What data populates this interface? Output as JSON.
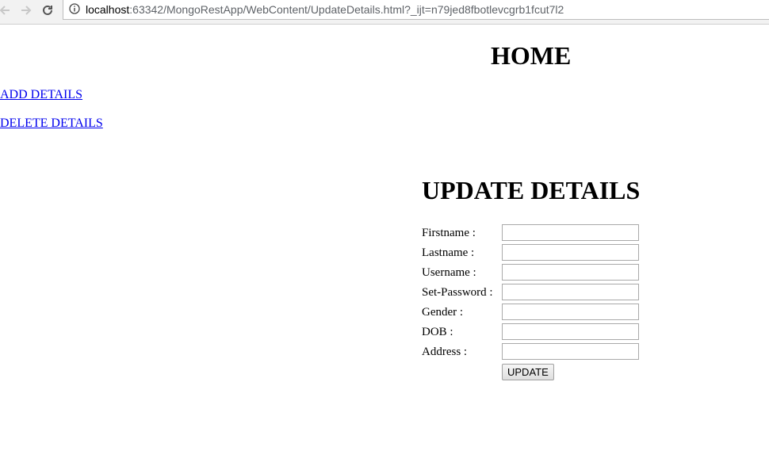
{
  "browser": {
    "url_host": "localhost",
    "url_rest": ":63342/MongoRestApp/WebContent/UpdateDetails.html?_ijt=n79jed8fbotlevcgrb1fcut7l2",
    "icons": {
      "back": "arrow-left-icon",
      "forward": "arrow-right-icon",
      "reload": "reload-icon",
      "info": "info-icon"
    }
  },
  "page": {
    "home_title": "HOME",
    "links": {
      "add": "ADD DETAILS",
      "delete": "DELETE DETAILS"
    },
    "form_title": "UPDATE DETAILS",
    "fields": {
      "firstname": {
        "label": "Firstname :",
        "value": ""
      },
      "lastname": {
        "label": "Lastname :",
        "value": ""
      },
      "username": {
        "label": "Username :",
        "value": ""
      },
      "password": {
        "label": "Set-Password :",
        "value": ""
      },
      "gender": {
        "label": "Gender :",
        "value": ""
      },
      "dob": {
        "label": "DOB :",
        "value": ""
      },
      "address": {
        "label": "Address :",
        "value": ""
      }
    },
    "submit_label": "UPDATE"
  },
  "colors": {
    "link": "#0000ee",
    "text": "#000000"
  }
}
